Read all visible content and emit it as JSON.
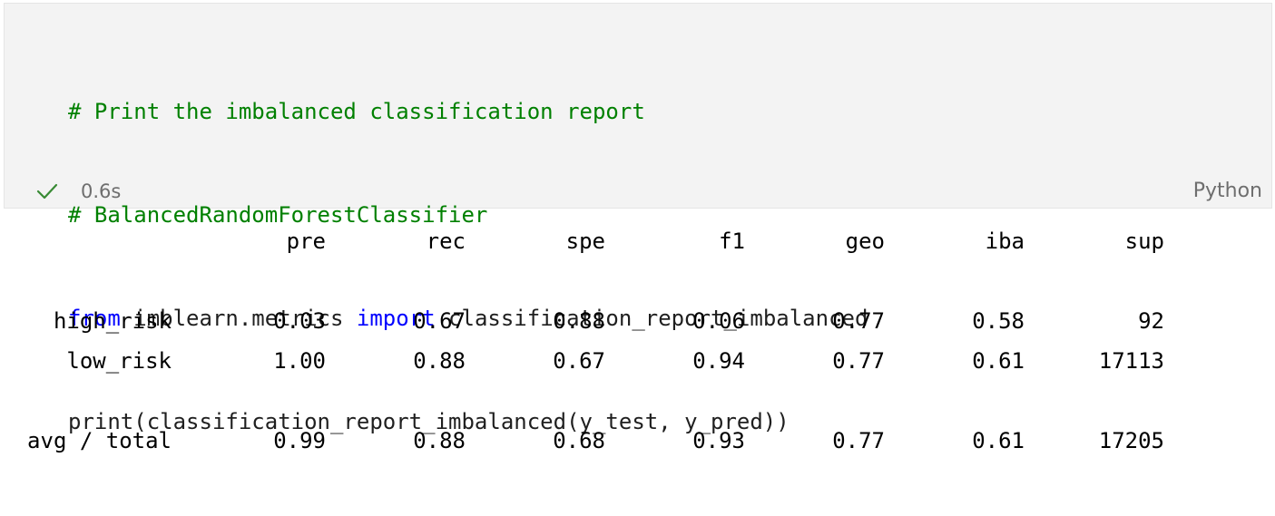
{
  "cell": {
    "code_lines": [
      [
        {
          "t": "# Print the imbalanced classification report",
          "c": "comment"
        }
      ],
      [
        {
          "t": "# BalancedRandomForestClassifier",
          "c": "comment"
        }
      ],
      [
        {
          "t": "from",
          "c": "keyword"
        },
        {
          "t": " imblearn.metrics ",
          "c": "text"
        },
        {
          "t": "import",
          "c": "keyword"
        },
        {
          "t": " classification_report_imbalanced",
          "c": "text"
        }
      ],
      [
        {
          "t": "print(classification_report_imbalanced(y_test, y_pred))",
          "c": "text"
        }
      ]
    ],
    "status_icon": "check-icon",
    "exec_time": "0.6s",
    "language": "Python",
    "colors": {
      "comment": "#008000",
      "keyword": "#0000ff",
      "text": "#1f1f1f",
      "check": "#388a34",
      "cell_bg": "#f3f3f3"
    }
  },
  "output": {
    "headers": [
      "pre",
      "rec",
      "spe",
      "f1",
      "geo",
      "iba",
      "sup"
    ],
    "rows": [
      {
        "label": "high_risk",
        "values": [
          "0.03",
          "0.67",
          "0.88",
          "0.06",
          "0.77",
          "0.58",
          "92"
        ]
      },
      {
        "label": "low_risk",
        "values": [
          "1.00",
          "0.88",
          "0.67",
          "0.94",
          "0.77",
          "0.61",
          "17113"
        ]
      }
    ],
    "total": {
      "label": "avg / total",
      "values": [
        "0.99",
        "0.88",
        "0.68",
        "0.93",
        "0.77",
        "0.61",
        "17205"
      ]
    }
  }
}
